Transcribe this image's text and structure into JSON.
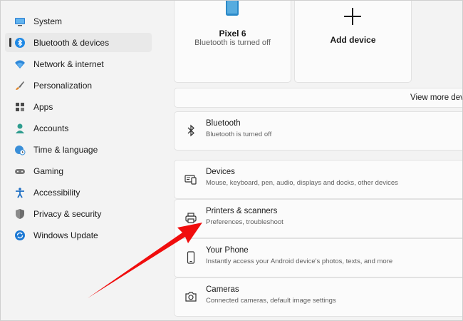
{
  "sidebar": {
    "items": [
      {
        "label": "System",
        "icon": "monitor-icon"
      },
      {
        "label": "Bluetooth & devices",
        "icon": "bluetooth-icon",
        "selected": true
      },
      {
        "label": "Network & internet",
        "icon": "wifi-icon"
      },
      {
        "label": "Personalization",
        "icon": "brush-icon"
      },
      {
        "label": "Apps",
        "icon": "apps-icon"
      },
      {
        "label": "Accounts",
        "icon": "person-icon"
      },
      {
        "label": "Time & language",
        "icon": "globe-clock-icon"
      },
      {
        "label": "Gaming",
        "icon": "gamepad-icon"
      },
      {
        "label": "Accessibility",
        "icon": "accessibility-icon"
      },
      {
        "label": "Privacy & security",
        "icon": "shield-icon"
      },
      {
        "label": "Windows Update",
        "icon": "update-icon"
      }
    ]
  },
  "devices": {
    "pixel": {
      "name": "Pixel 6",
      "status": "Bluetooth is turned off",
      "icon": "phone-icon"
    },
    "add": {
      "label": "Add device",
      "icon": "plus-icon"
    },
    "view_more": "View more devic"
  },
  "rows": {
    "bluetooth": {
      "title": "Bluetooth",
      "subtitle": "Bluetooth is turned off",
      "icon": "bluetooth-icon"
    },
    "devices": {
      "title": "Devices",
      "subtitle": "Mouse, keyboard, pen, audio, displays and docks, other devices",
      "icon": "devices-icon"
    },
    "printers": {
      "title": "Printers & scanners",
      "subtitle": "Preferences, troubleshoot",
      "icon": "printer-icon"
    },
    "phone": {
      "title": "Your Phone",
      "subtitle": "Instantly access your Android device's photos, texts, and more",
      "icon": "phone-icon"
    },
    "cameras": {
      "title": "Cameras",
      "subtitle": "Connected cameras, default image settings",
      "icon": "camera-icon"
    }
  },
  "colors": {
    "annotation_arrow": "#f00d0d",
    "accent": "#0067c0",
    "phone_body": "#2b89c8"
  }
}
